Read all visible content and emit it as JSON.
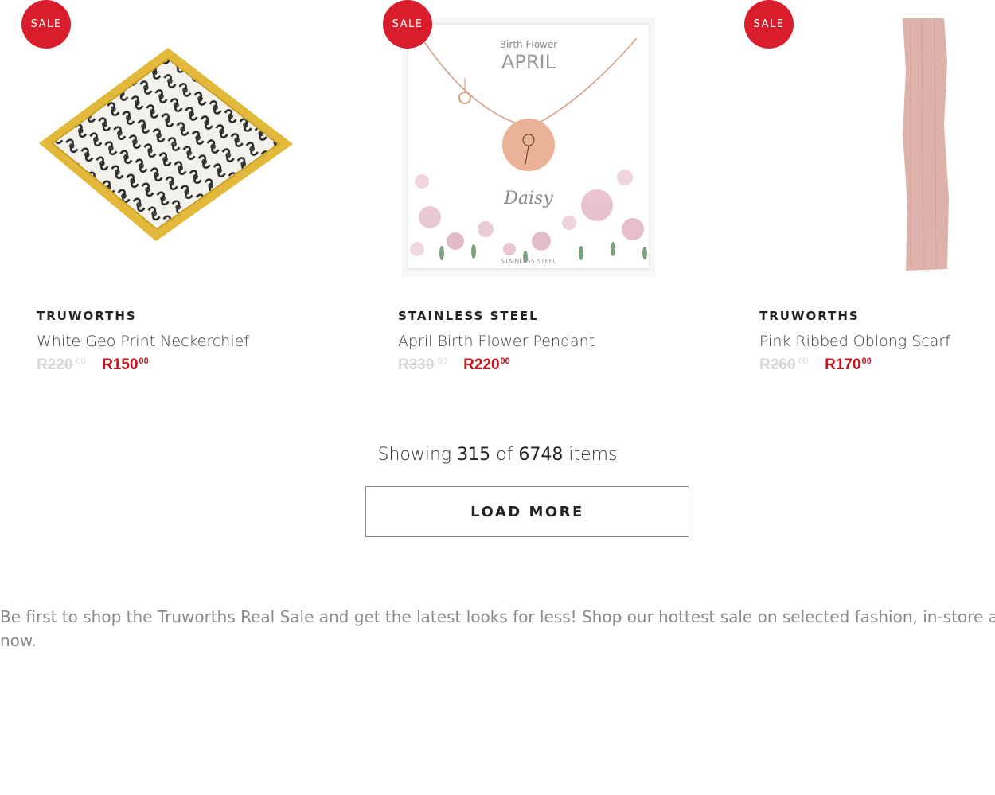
{
  "products": [
    {
      "badge": "SALE",
      "brand": "TRUWORTHS",
      "name": "White Geo Print Neckerchief",
      "old_price": "R220",
      "old_cents": "00",
      "new_price": "R150",
      "new_cents": "00"
    },
    {
      "badge": "SALE",
      "brand": "STAINLESS STEEL",
      "name": "April Birth Flower Pendant",
      "old_price": "R330",
      "old_cents": "00",
      "new_price": "R220",
      "new_cents": "00",
      "card": {
        "subtitle": "Birth Flower",
        "month": "APRIL",
        "flower": "Daisy",
        "material": "STAINLESS STEEL"
      }
    },
    {
      "badge": "SALE",
      "brand": "TRUWORTHS",
      "name": "Pink Ribbed Oblong Scarf",
      "old_price": "R260",
      "old_cents": "00",
      "new_price": "R170",
      "new_cents": "00"
    }
  ],
  "pagination": {
    "prefix": "Showing",
    "shown": "315",
    "of": "of",
    "total": "6748",
    "suffix": "items",
    "button_label": "LOAD MORE"
  },
  "description": {
    "line1": "Be first to shop the Truworths Real Sale and get the latest looks for less! Shop our hottest sale on selected fashion, in-store and on",
    "line2": "now."
  },
  "colors": {
    "sale_badge": "#d81e2c",
    "sale_price": "#c4161c",
    "old_price": "#d8d8d8"
  }
}
